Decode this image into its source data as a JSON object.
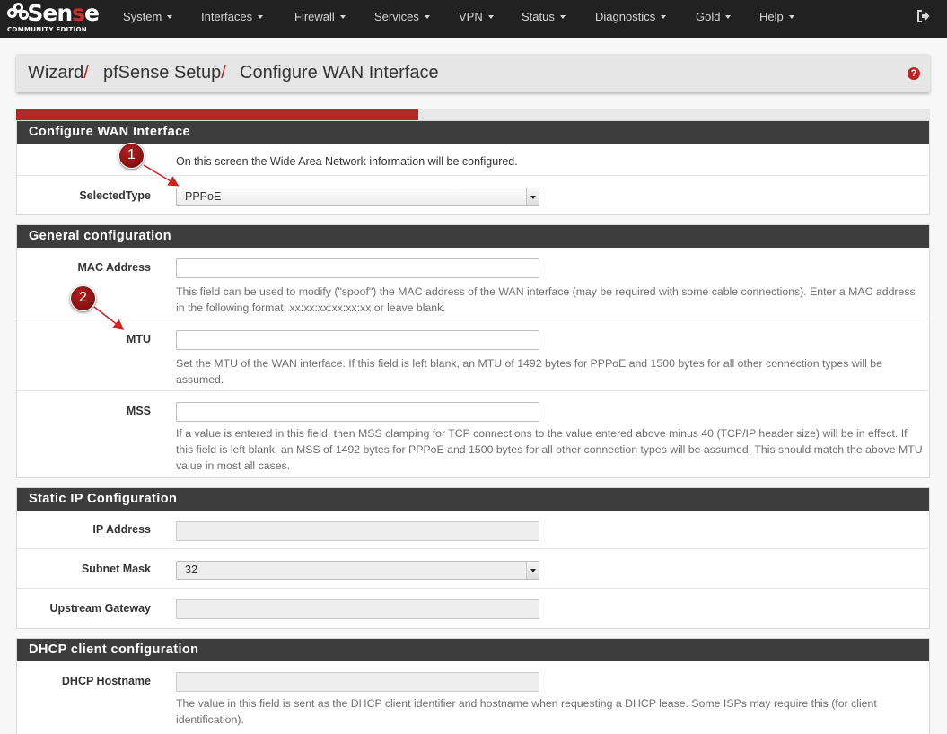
{
  "brand": {
    "logo_text_a": "Sen",
    "logo_text_b": "s",
    "logo_text_c": "e",
    "edition": "COMMUNITY EDITION"
  },
  "nav": {
    "items": [
      {
        "label": "System"
      },
      {
        "label": "Interfaces"
      },
      {
        "label": "Firewall"
      },
      {
        "label": "Services"
      },
      {
        "label": "VPN"
      },
      {
        "label": "Status"
      },
      {
        "label": "Diagnostics"
      },
      {
        "label": "Gold"
      },
      {
        "label": "Help"
      }
    ]
  },
  "breadcrumb": {
    "items": [
      "Wizard",
      "pfSense Setup",
      "Configure WAN Interface"
    ],
    "separator": "/"
  },
  "progress": {
    "percent": 44
  },
  "colors": {
    "accent": "#b52626",
    "navbar": "#212121",
    "panel_header": "#3d3d3d"
  },
  "sections": {
    "wan": {
      "title": "Configure WAN Interface",
      "intro": "On this screen the Wide Area Network information will be configured.",
      "selected_type_label": "SelectedType",
      "selected_type_value": "PPPoE"
    },
    "general": {
      "title": "General configuration",
      "mac_label": "MAC Address",
      "mac_help": "This field can be used to modify (\"spoof\") the MAC address of the WAN interface (may be required with some cable connections). Enter a MAC address in the following format: xx:xx:xx:xx:xx:xx or leave blank.",
      "mtu_label": "MTU",
      "mtu_help": "Set the MTU of the WAN interface. If this field is left blank, an MTU of 1492 bytes for PPPoE and 1500 bytes for all other connection types will be assumed.",
      "mss_label": "MSS",
      "mss_help": "If a value is entered in this field, then MSS clamping for TCP connections to the value entered above minus 40 (TCP/IP header size) will be in effect. If this field is left blank, an MSS of 1492 bytes for PPPoE and 1500 bytes for all other connection types will be assumed. This should match the above MTU value in most all cases."
    },
    "static": {
      "title": "Static IP Configuration",
      "ip_label": "IP Address",
      "subnet_label": "Subnet Mask",
      "subnet_value": "32",
      "gateway_label": "Upstream Gateway"
    },
    "dhcp": {
      "title": "DHCP client configuration",
      "hostname_label": "DHCP Hostname",
      "hostname_help": "The value in this field is sent as the DHCP client identifier and hostname when requesting a DHCP lease. Some ISPs may require this (for client identification)."
    }
  },
  "annotations": {
    "marker_1": "1",
    "marker_2": "2"
  }
}
